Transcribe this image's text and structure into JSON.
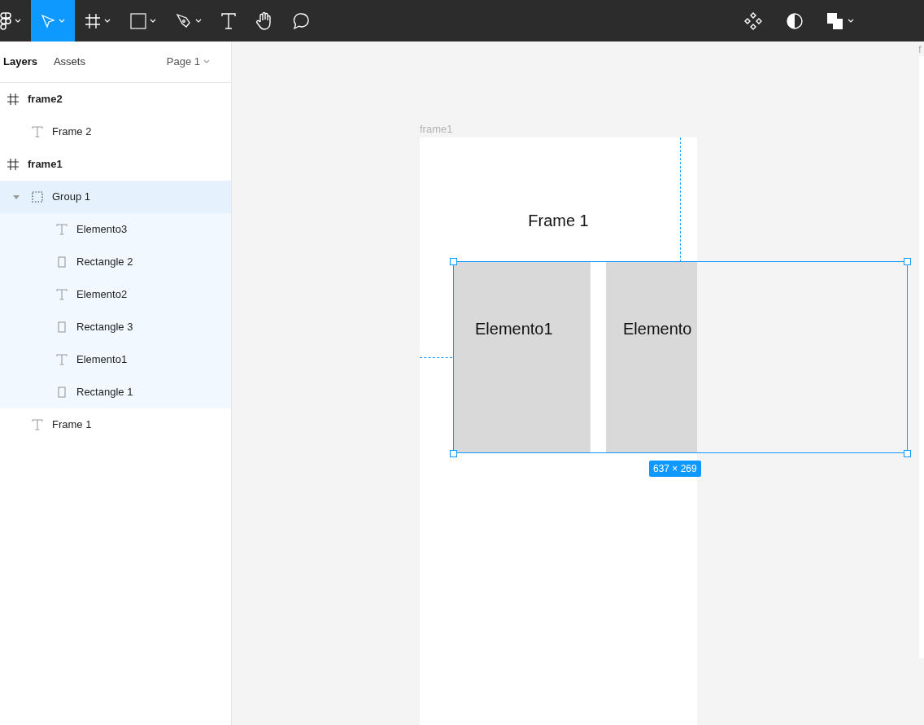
{
  "toolbar": {
    "left_tools": [
      {
        "kind": "logo",
        "selected": false,
        "has_menu": true
      },
      {
        "kind": "move",
        "selected": true,
        "has_menu": true
      },
      {
        "kind": "frame",
        "selected": false,
        "has_menu": true
      },
      {
        "kind": "rectangle",
        "selected": false,
        "has_menu": true
      },
      {
        "kind": "pen",
        "selected": false,
        "has_menu": true
      },
      {
        "kind": "text",
        "selected": false,
        "has_menu": false
      },
      {
        "kind": "hand",
        "selected": false,
        "has_menu": false
      },
      {
        "kind": "comment",
        "selected": false,
        "has_menu": false
      }
    ],
    "right_tools": [
      {
        "kind": "components",
        "has_menu": false
      },
      {
        "kind": "contrast",
        "has_menu": false
      },
      {
        "kind": "boolean",
        "has_menu": true
      }
    ]
  },
  "sidebar": {
    "tabs": [
      {
        "label": "Layers",
        "selected": true
      },
      {
        "label": "Assets",
        "selected": false
      }
    ],
    "page": "Page 1",
    "layers": [
      {
        "name": "frame2",
        "kind": "frame",
        "selected": false,
        "children": [
          {
            "name": "Frame 2",
            "kind": "text",
            "selected": false
          }
        ]
      },
      {
        "name": "frame1",
        "kind": "frame",
        "selected": false,
        "children": [
          {
            "name": "Group 1",
            "kind": "group",
            "selected": true,
            "expanded": true,
            "children": [
              {
                "name": "Elemento3",
                "kind": "text",
                "selected": false
              },
              {
                "name": "Rectangle 2",
                "kind": "rectangle",
                "selected": false
              },
              {
                "name": "Elemento2",
                "kind": "text",
                "selected": false
              },
              {
                "name": "Rectangle 3",
                "kind": "rectangle",
                "selected": false
              },
              {
                "name": "Elemento1",
                "kind": "text",
                "selected": false
              },
              {
                "name": "Rectangle 1",
                "kind": "rectangle",
                "selected": false
              }
            ]
          },
          {
            "name": "Frame 1",
            "kind": "text",
            "selected": false
          }
        ]
      }
    ]
  },
  "canvas": {
    "frame_label": "frame1",
    "frame_title": "Frame 1",
    "rectangles": [
      {
        "label": "Elemento1"
      },
      {
        "label": "Elemento"
      }
    ],
    "selection_size": "637 × 269",
    "next_frame_label": "f"
  }
}
